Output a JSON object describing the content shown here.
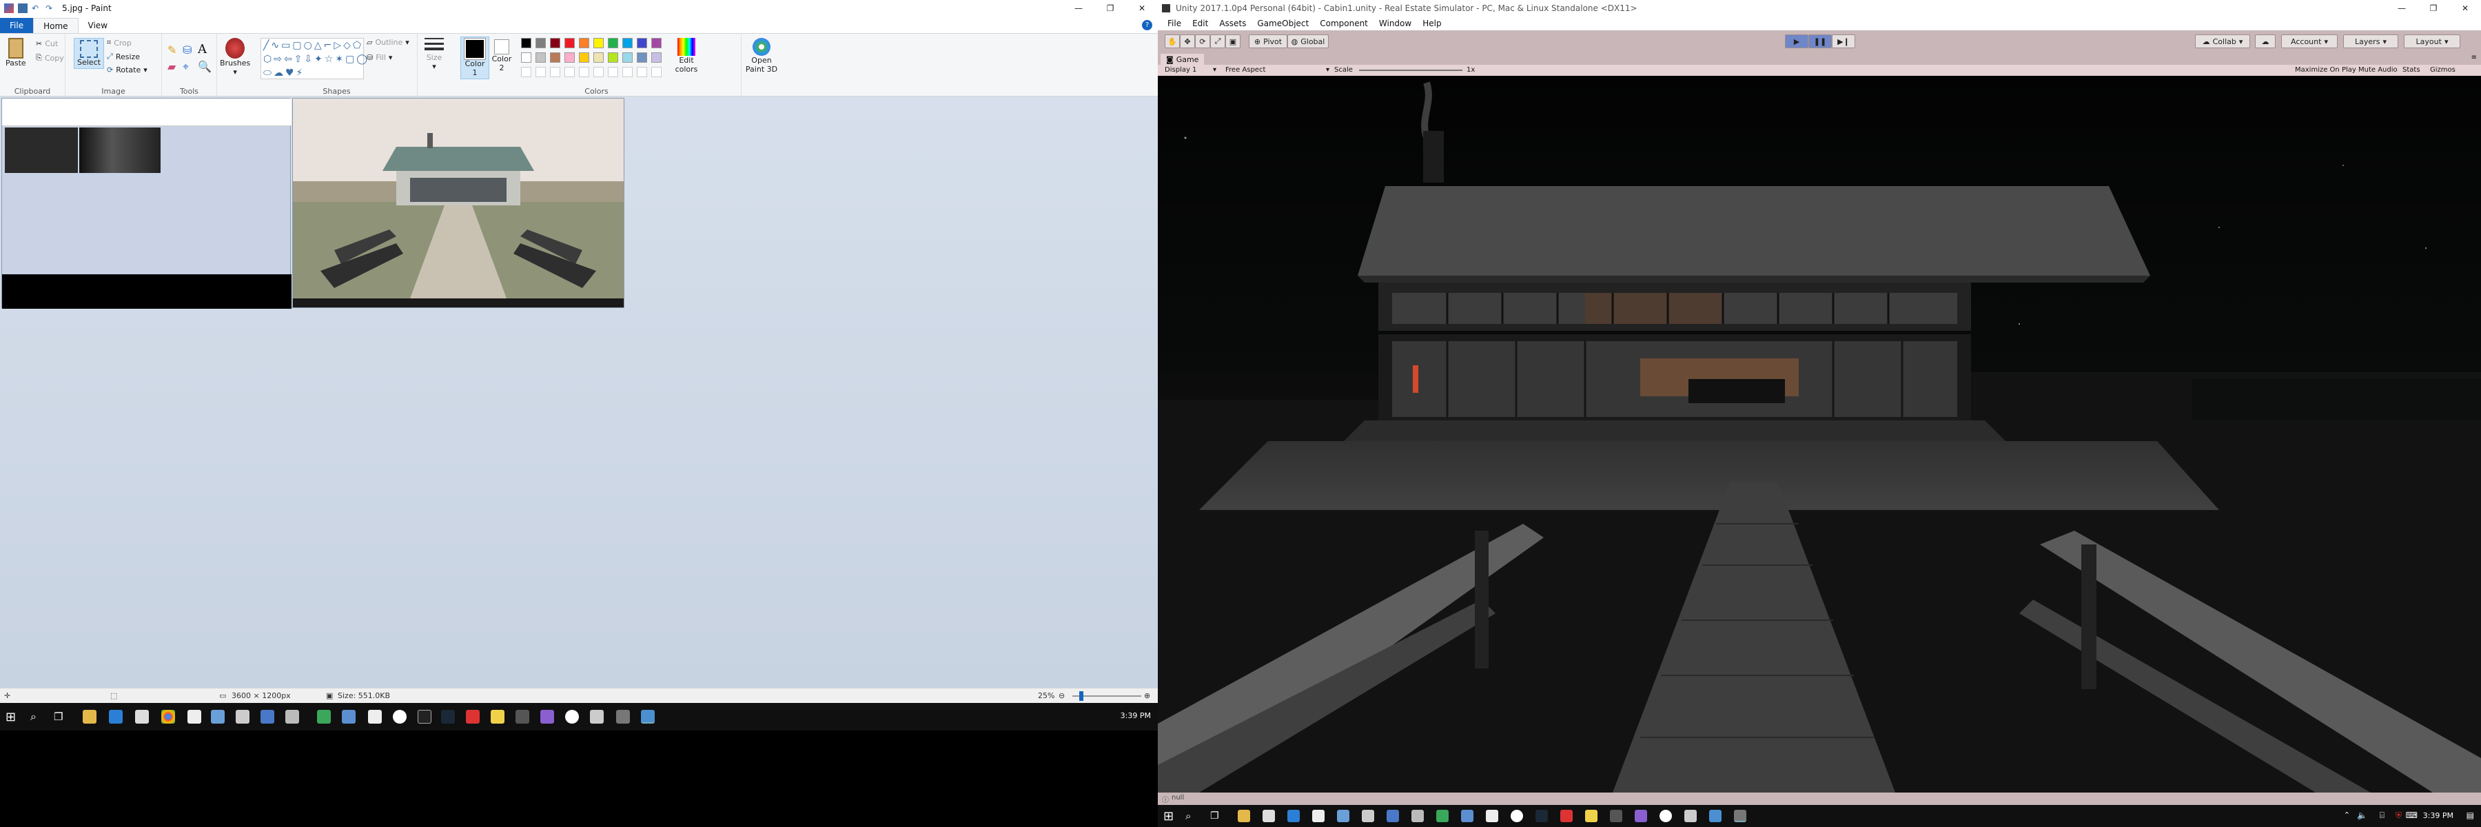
{
  "paint": {
    "title": "5.jpg - Paint",
    "tabs": [
      "File",
      "Home",
      "View"
    ],
    "clipboard": {
      "paste": "Paste",
      "cut": "Cut",
      "copy": "Copy",
      "caption": "Clipboard"
    },
    "image": {
      "select": "Select",
      "crop": "Crop",
      "resize": "Resize",
      "rotate": "Rotate",
      "caption": "Image"
    },
    "tools": {
      "caption": "Tools"
    },
    "brushes": "Brushes",
    "shapes": {
      "outline": "Outline",
      "fill": "Fill",
      "caption": "Shapes"
    },
    "size": "Size",
    "color1": "Color 1",
    "color2": "Color 2",
    "colors_caption": "Colors",
    "edit_colors": "Edit colors",
    "open_paint3d": "Open Paint 3D",
    "palette_row1": [
      "#000000",
      "#7f7f7f",
      "#880015",
      "#ed1c24",
      "#ff7f27",
      "#fff200",
      "#22b14c",
      "#00a2e8",
      "#3f48cc",
      "#a349a4"
    ],
    "palette_row2": [
      "#ffffff",
      "#c3c3c3",
      "#b97a57",
      "#ffaec9",
      "#ffc90e",
      "#efe4b0",
      "#b5e61d",
      "#99d9ea",
      "#7092be",
      "#c8bfe7"
    ],
    "status": {
      "dimensions": "3600 × 1200px",
      "size": "Size: 551.0KB",
      "zoom": "25%"
    }
  },
  "taskbar": {
    "time": "3:39 PM"
  },
  "unity": {
    "title": "Unity 2017.1.0p4 Personal (64bit) - Cabin1.unity - Real Estate Simulator - PC, Mac & Linux Standalone <DX11>",
    "menu": [
      "File",
      "Edit",
      "Assets",
      "GameObject",
      "Component",
      "Window",
      "Help"
    ],
    "toolbar": {
      "pivot": "Pivot",
      "global": "Global",
      "collab": "Collab",
      "account": "Account",
      "layers": "Layers",
      "layout": "Layout"
    },
    "game_tab": "Game",
    "gamebar": {
      "display": "Display 1",
      "aspect": "Free Aspect",
      "scale": "Scale",
      "scale_value": "1x",
      "maximize": "Maximize On Play",
      "mute": "Mute Audio",
      "stats": "Stats",
      "gizmos": "Gizmos"
    },
    "status": "null"
  }
}
